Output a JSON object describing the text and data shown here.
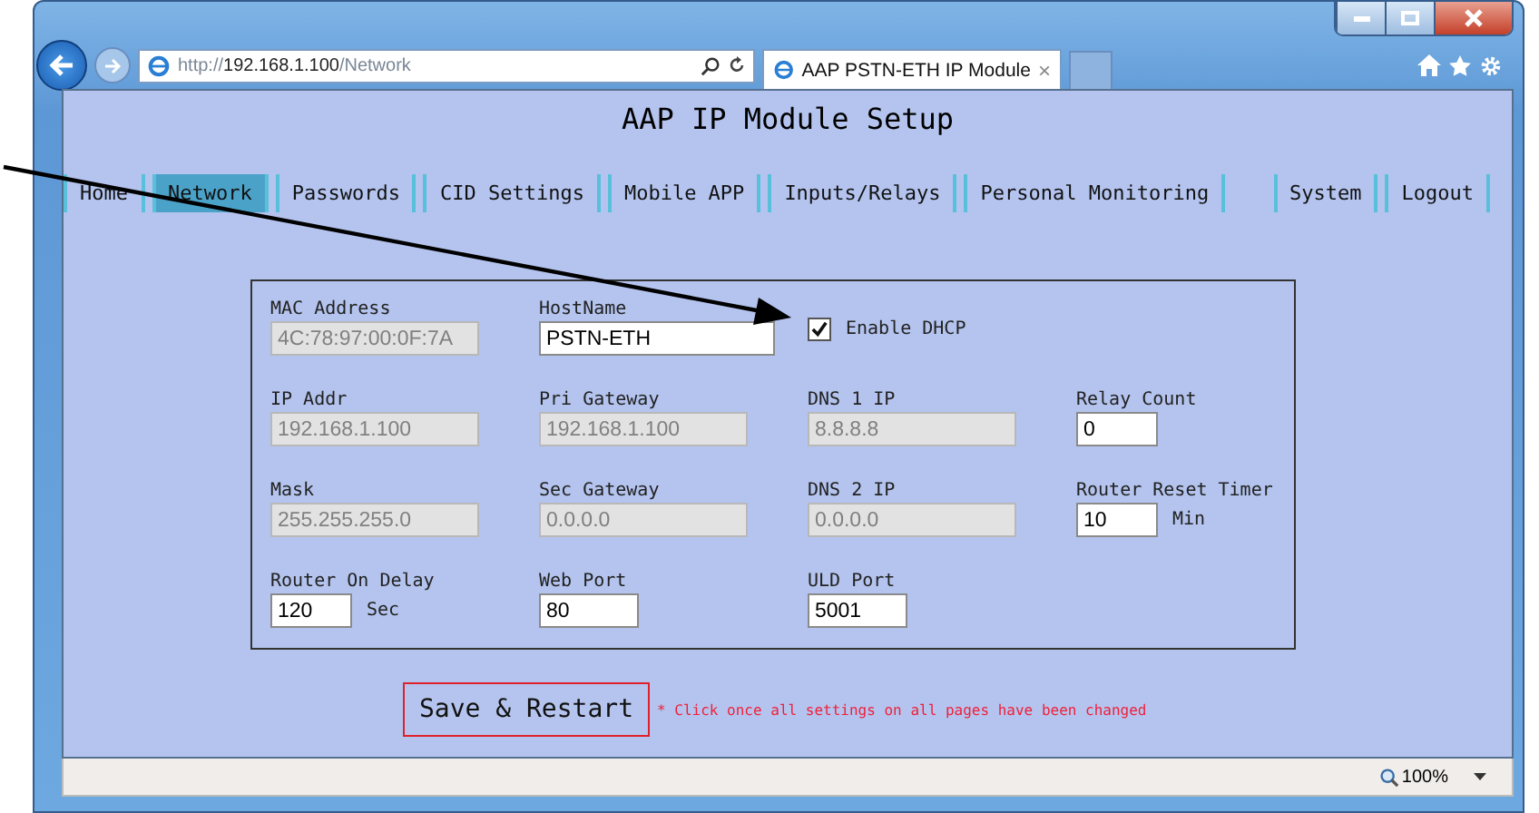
{
  "browser": {
    "address": "http://**192.168.1.100**/Network",
    "tab": {
      "title": "AAP PSTN-ETH IP Module",
      "close": "×"
    },
    "zoom": "100%"
  },
  "page_title": "AAP IP Module Setup",
  "nav": {
    "left": [
      {
        "label": "Home",
        "selected": false
      },
      {
        "label": "Network",
        "selected": true
      },
      {
        "label": "Passwords",
        "selected": false
      },
      {
        "label": "CID Settings",
        "selected": false
      },
      {
        "label": "Mobile APP",
        "selected": false
      },
      {
        "label": "Inputs/Relays",
        "selected": false
      },
      {
        "label": "Personal Monitoring",
        "selected": false
      }
    ],
    "right": [
      {
        "label": "System",
        "selected": false
      },
      {
        "label": "Logout",
        "selected": false
      }
    ]
  },
  "form": {
    "rows": [
      [
        {
          "kind": "long",
          "label": "MAC Address",
          "value": "4C:78:97:00:0F:7A",
          "disabled": true
        },
        {
          "kind": "wide",
          "label": "HostName",
          "value": "PSTN-ETH",
          "disabled": false
        },
        {
          "kind": "checkbox",
          "label": "Enable DHCP",
          "checked": true
        }
      ],
      [
        {
          "kind": "long",
          "label": "IP Addr",
          "value": "192.168.1.100",
          "disabled": true
        },
        {
          "kind": "long",
          "label": "Pri Gateway",
          "value": "192.168.1.100",
          "disabled": true
        },
        {
          "kind": "long",
          "label": "DNS 1 IP",
          "value": "8.8.8.8",
          "disabled": true
        },
        {
          "kind": "short",
          "label": "Relay Count",
          "value": "0",
          "disabled": false
        }
      ],
      [
        {
          "kind": "long",
          "label": "Mask",
          "value": "255.255.255.0",
          "disabled": true
        },
        {
          "kind": "long",
          "label": "Sec Gateway",
          "value": "0.0.0.0",
          "disabled": true
        },
        {
          "kind": "long",
          "label": "DNS 2 IP",
          "value": "0.0.0.0",
          "disabled": true
        },
        {
          "kind": "short",
          "label": "Router Reset Timer",
          "value": "10",
          "unit": "Min",
          "disabled": false
        }
      ],
      [
        {
          "kind": "short",
          "label": "Router On Delay",
          "value": "120",
          "unit": "Sec",
          "disabled": false
        },
        {
          "kind": "medium",
          "label": "Web Port",
          "value": "80",
          "disabled": false
        },
        {
          "kind": "medium",
          "label": "ULD Port",
          "value": "5001",
          "disabled": false
        }
      ]
    ]
  },
  "save_button": "Save & Restart",
  "save_note": "* Click once all settings on all pages have been changed"
}
